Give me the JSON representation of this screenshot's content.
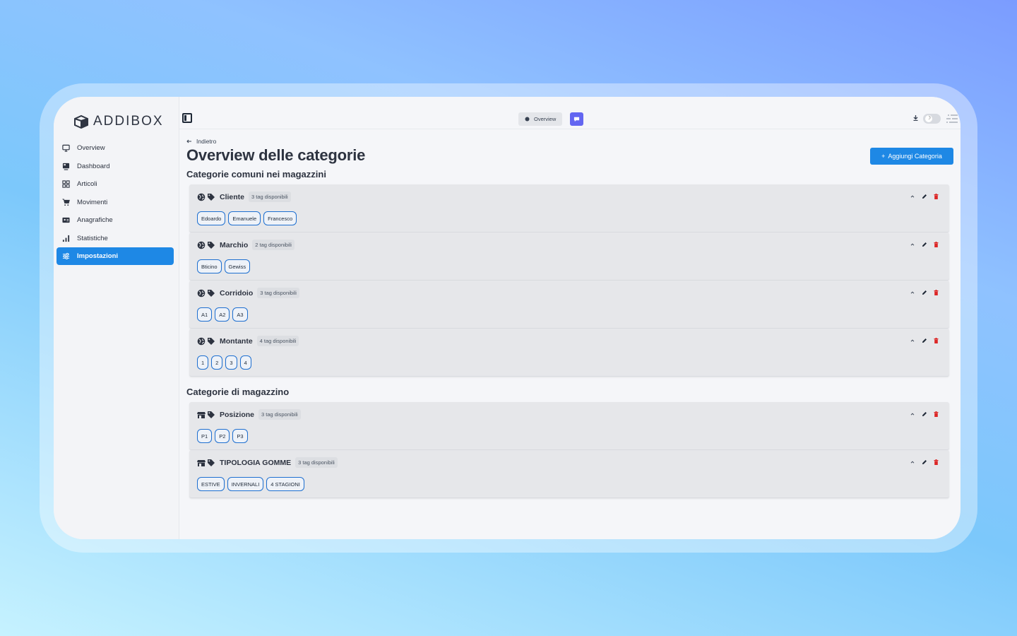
{
  "app": {
    "brand": "ADDIBOX"
  },
  "sidebar": {
    "items": [
      {
        "label": "Overview",
        "icon": "monitor-icon",
        "active": false
      },
      {
        "label": "Dashboard",
        "icon": "dashboard-icon",
        "active": false
      },
      {
        "label": "Articoli",
        "icon": "grid-icon",
        "active": false
      },
      {
        "label": "Movimenti",
        "icon": "cart-icon",
        "active": false
      },
      {
        "label": "Anagrafiche",
        "icon": "id-card-icon",
        "active": false
      },
      {
        "label": "Statistiche",
        "icon": "bar-chart-icon",
        "active": false
      },
      {
        "label": "Impostazioni",
        "icon": "sliders-icon",
        "active": true
      }
    ]
  },
  "topbar": {
    "overview_pill": "Overview"
  },
  "header": {
    "back": "Indietro",
    "title": "Overview delle categorie",
    "add_button": "Aggiungi Categoria"
  },
  "sections": [
    {
      "title": "Categorie comuni nei magazzini",
      "categories": [
        {
          "name": "Cliente",
          "count": "3 tag disponibili",
          "tags": [
            "Edoardo",
            "Emanuele",
            "Francesco"
          ]
        },
        {
          "name": "Marchio",
          "count": "2 tag disponibili",
          "tags": [
            "Bticino",
            "Gewiss"
          ]
        },
        {
          "name": "Corridoio",
          "count": "3 tag disponibili",
          "tags": [
            "A1",
            "A2",
            "A3"
          ]
        },
        {
          "name": "Montante",
          "count": "4 tag disponibili",
          "tags": [
            "1",
            "2",
            "3",
            "4"
          ]
        }
      ]
    },
    {
      "title": "Categorie di magazzino",
      "categories": [
        {
          "name": "Posizione",
          "count": "3 tag disponibili",
          "tags": [
            "P1",
            "P2",
            "P3"
          ]
        },
        {
          "name": "TIPOLOGIA GOMME",
          "count": "3 tag disponibili",
          "tags": [
            "ESTIVE",
            "INVERNALI",
            "4 STAGIONI"
          ]
        }
      ]
    }
  ],
  "colors": {
    "accent": "#1e88e5",
    "delete": "#dc2626",
    "chat": "#6366f1"
  }
}
